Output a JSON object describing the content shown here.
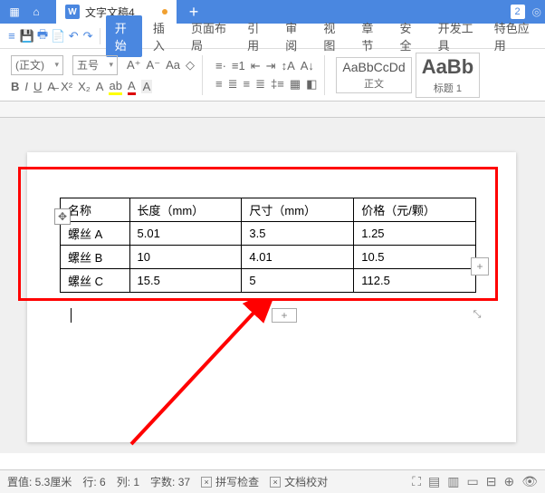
{
  "titlebar": {
    "doc_title": "文字文稿4",
    "badge": "2"
  },
  "menu": {
    "tabs": [
      "开始",
      "插入",
      "页面布局",
      "引用",
      "审阅",
      "视图",
      "章节",
      "安全",
      "开发工具",
      "特色应用"
    ]
  },
  "ribbon": {
    "font_name": "(正文)",
    "font_size": "五号",
    "style1_preview": "AaBbCcDd",
    "style1_label": "正文",
    "style2_preview": "AaBb",
    "style2_label": "标题 1"
  },
  "table": {
    "headers": [
      "名称",
      "长度（mm）",
      "尺寸（mm）",
      "价格（元/颗）"
    ],
    "rows": [
      [
        "螺丝 A",
        "5.01",
        "3.5",
        "1.25"
      ],
      [
        "螺丝 B",
        "10",
        "4.01",
        "10.5"
      ],
      [
        "螺丝 C",
        "15.5",
        "5",
        "112.5"
      ]
    ]
  },
  "status": {
    "position": "置值: 5.3厘米",
    "line": "行: 6",
    "col": "列: 1",
    "chars": "字数: 37",
    "spell": "拼写检查",
    "proof": "文档校对"
  },
  "chart_data": {
    "type": "table",
    "title": "",
    "columns": [
      "名称",
      "长度（mm）",
      "尺寸（mm）",
      "价格（元/颗）"
    ],
    "data": [
      {
        "名称": "螺丝 A",
        "长度（mm）": 5.01,
        "尺寸（mm）": 3.5,
        "价格（元/颗）": 1.25
      },
      {
        "名称": "螺丝 B",
        "长度（mm）": 10,
        "尺寸（mm）": 4.01,
        "价格（元/颗）": 10.5
      },
      {
        "名称": "螺丝 C",
        "长度（mm）": 15.5,
        "尺寸（mm）": 5,
        "价格（元/颗）": 112.5
      }
    ]
  }
}
